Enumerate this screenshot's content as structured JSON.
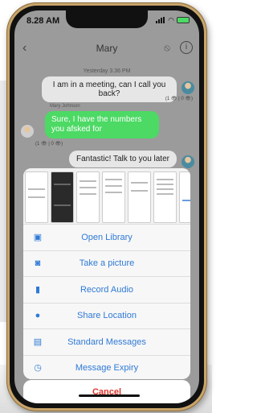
{
  "status": {
    "time": "8.28 AM"
  },
  "header": {
    "title": "Mary"
  },
  "chat": {
    "timestamp": "Yesterday 3.36 PM",
    "messages": [
      {
        "text": "I am in a meeting, can I call you back?",
        "meta": "(1 👁 | 0 👁)"
      },
      {
        "sender": "Mary Johnson",
        "text": "Sure, I have the numbers you afsked for",
        "meta": "(1 👁 | 0 👁)"
      },
      {
        "text": "Fantastic! Talk to you later"
      }
    ]
  },
  "sheet": {
    "actions": [
      {
        "label": "Open Library",
        "icon": "image-icon"
      },
      {
        "label": "Take a picture",
        "icon": "camera-icon"
      },
      {
        "label": "Record Audio",
        "icon": "microphone-icon"
      },
      {
        "label": "Share Location",
        "icon": "location-pin-icon"
      },
      {
        "label": "Standard Messages",
        "icon": "document-icon"
      },
      {
        "label": "Message Expiry",
        "icon": "clock-icon"
      }
    ],
    "cancel_label": "Cancel"
  },
  "colors": {
    "accent": "#2f7ad6",
    "incoming_bubble": "#4cd964",
    "cancel": "#e0372c"
  }
}
